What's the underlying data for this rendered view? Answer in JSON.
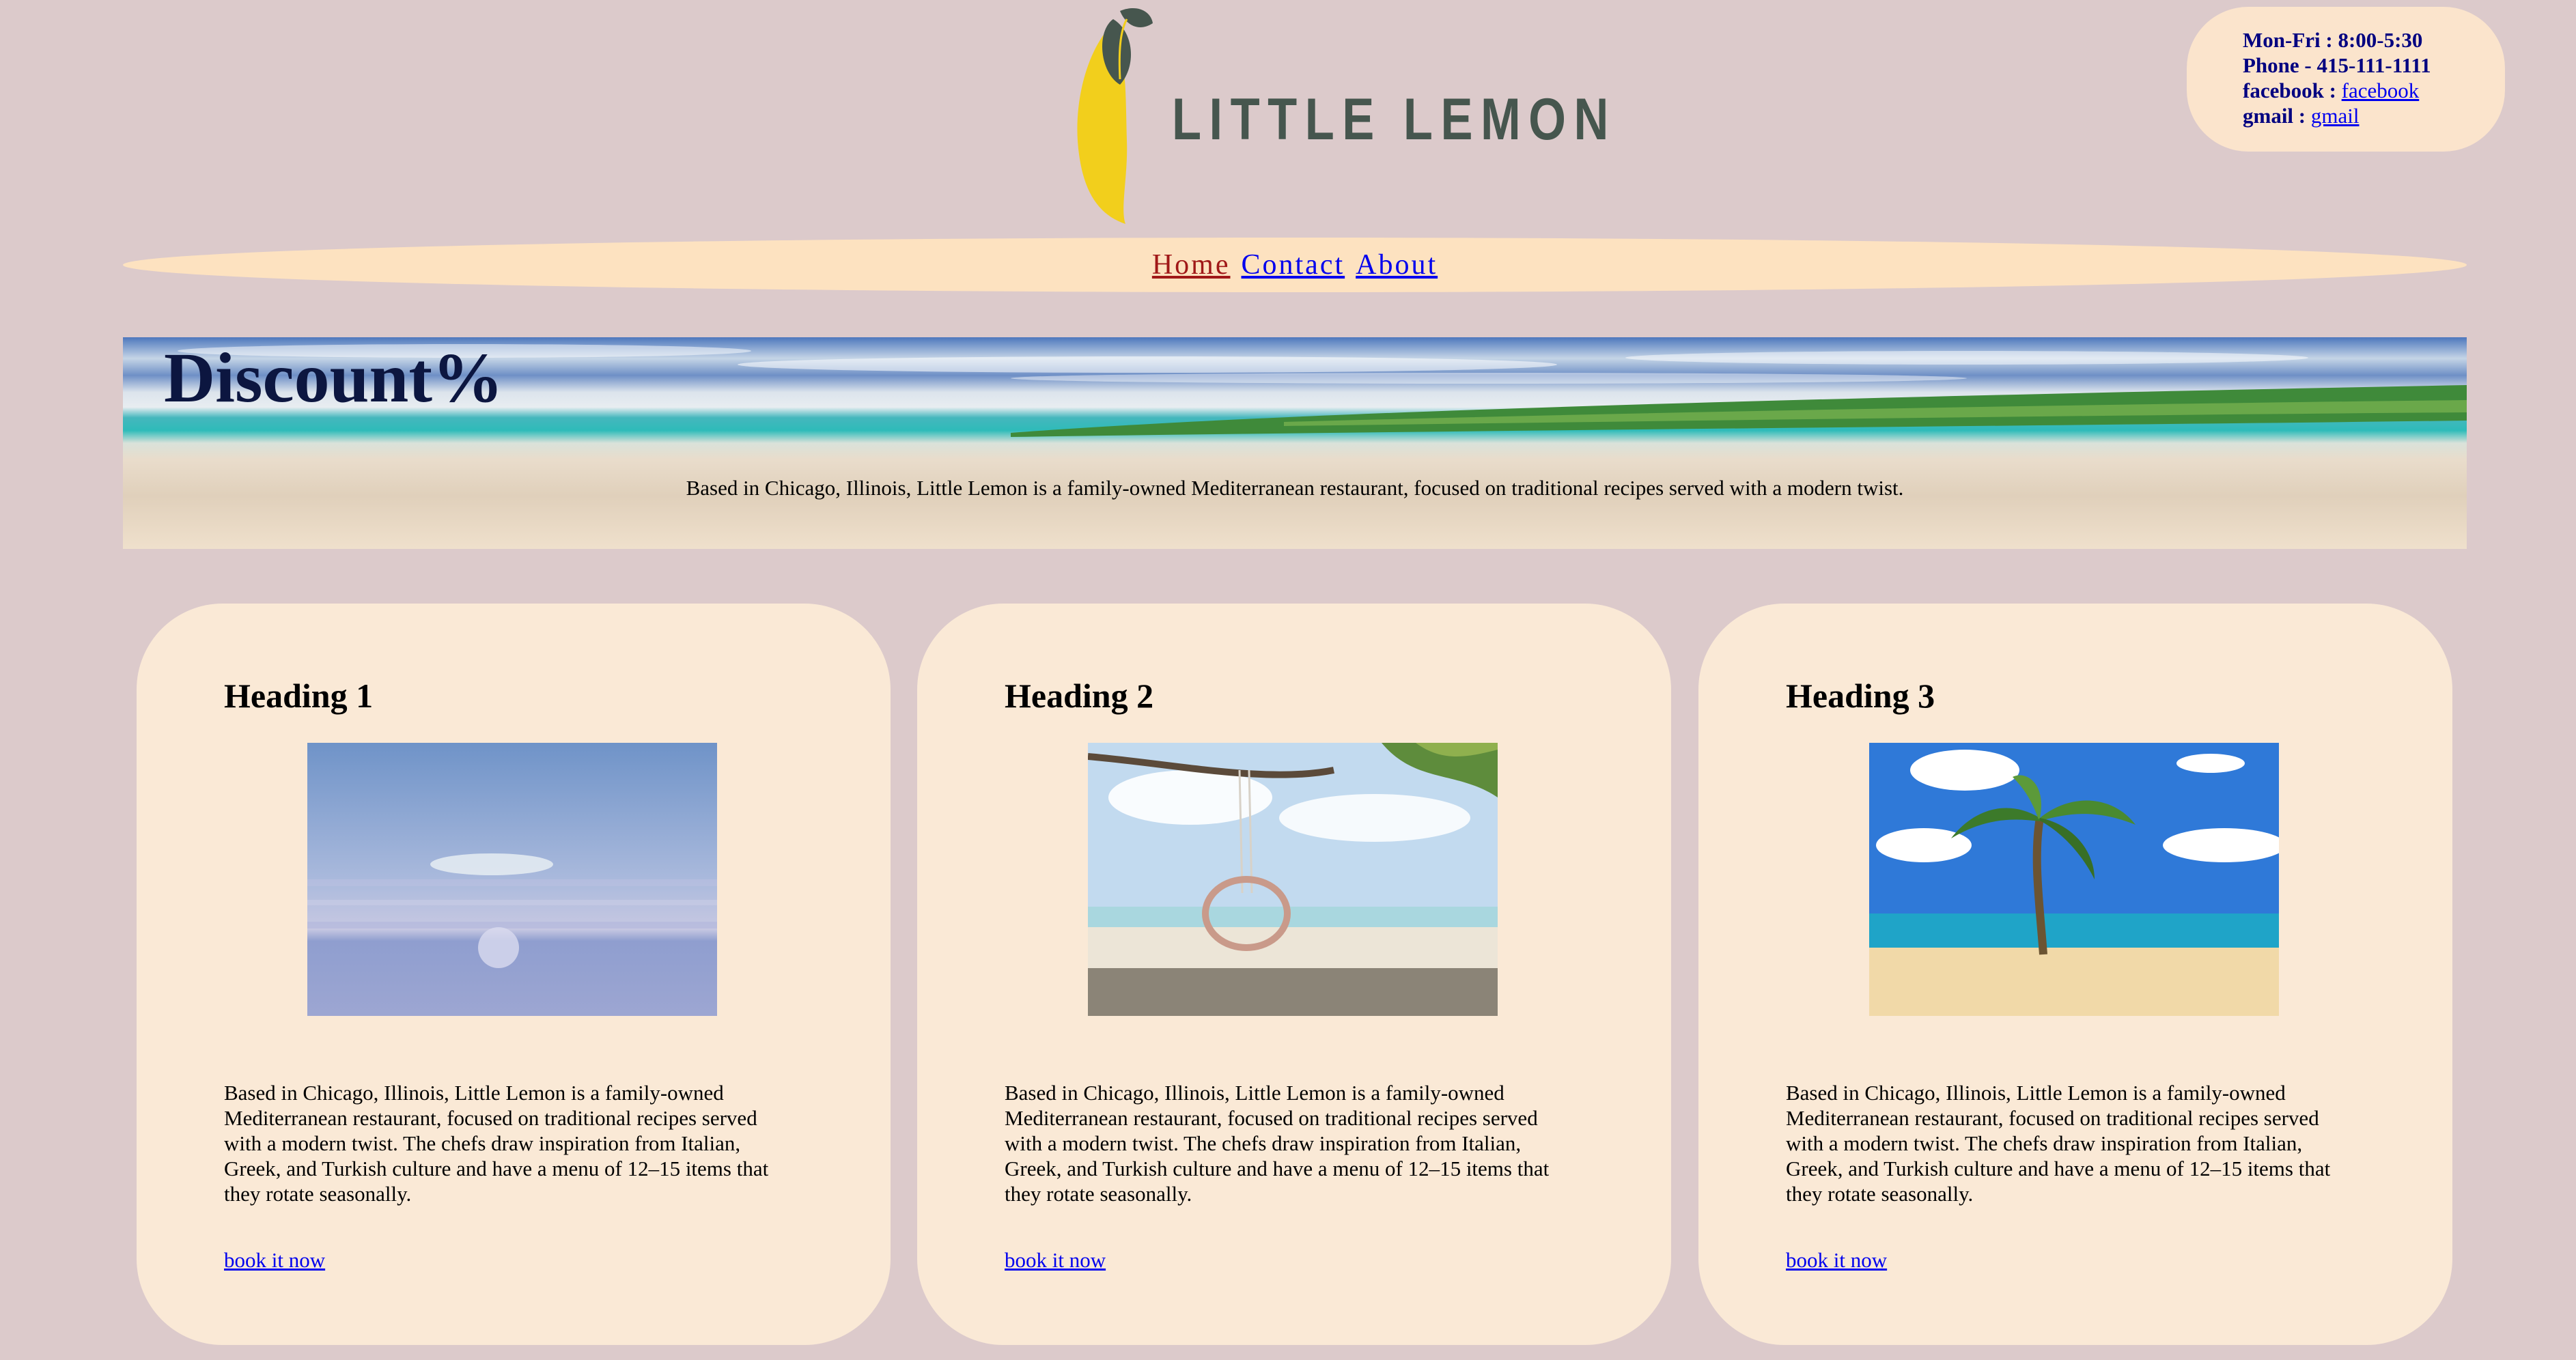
{
  "brand": {
    "name": "LITTLE LEMON"
  },
  "contact": {
    "hours": "Mon-Fri : 8:00-5:30",
    "phone": "Phone - 415-111-1111",
    "facebook_label": "facebook :",
    "facebook_link": "facebook",
    "gmail_label": "gmail :",
    "gmail_link": "gmail"
  },
  "nav": {
    "items": [
      "Home",
      "Contact",
      "About"
    ],
    "active": "Home"
  },
  "hero": {
    "title": "Discount%",
    "text": "Based in Chicago, Illinois, Little Lemon is a family-owned Mediterranean restaurant, focused on traditional recipes served with a modern twist."
  },
  "cards": [
    {
      "heading": "Heading 1",
      "image_icon": "sunset-sea-image",
      "text": "Based in Chicago, Illinois, Little Lemon is a family-owned Mediterranean restaurant, focused on traditional recipes served with a modern twist. The chefs draw inspiration from Italian, Greek, and Turkish culture and have a menu of 12–15 items that they rotate seasonally.",
      "link": "book it now"
    },
    {
      "heading": "Heading 2",
      "image_icon": "beach-swing-image",
      "text": "Based in Chicago, Illinois, Little Lemon is a family-owned Mediterranean restaurant, focused on traditional recipes served with a modern twist. The chefs draw inspiration from Italian, Greek, and Turkish culture and have a menu of 12–15 items that they rotate seasonally.",
      "link": "book it now"
    },
    {
      "heading": "Heading 3",
      "image_icon": "palm-tree-beach-image",
      "text": "Based in Chicago, Illinois, Little Lemon is a family-owned Mediterranean restaurant, focused on traditional recipes served with a modern twist. The chefs draw inspiration from Italian, Greek, and Turkish culture and have a menu of 12–15 items that they rotate seasonally.",
      "link": "book it now"
    }
  ],
  "colors": {
    "page_bg": "#dccacb",
    "card_bg": "#fae9d6",
    "nav_bg": "#fde2c0",
    "lemon": "#f2cf1c",
    "leaf": "#46564e",
    "active_link": "#a01818",
    "link": "#0000ee"
  }
}
